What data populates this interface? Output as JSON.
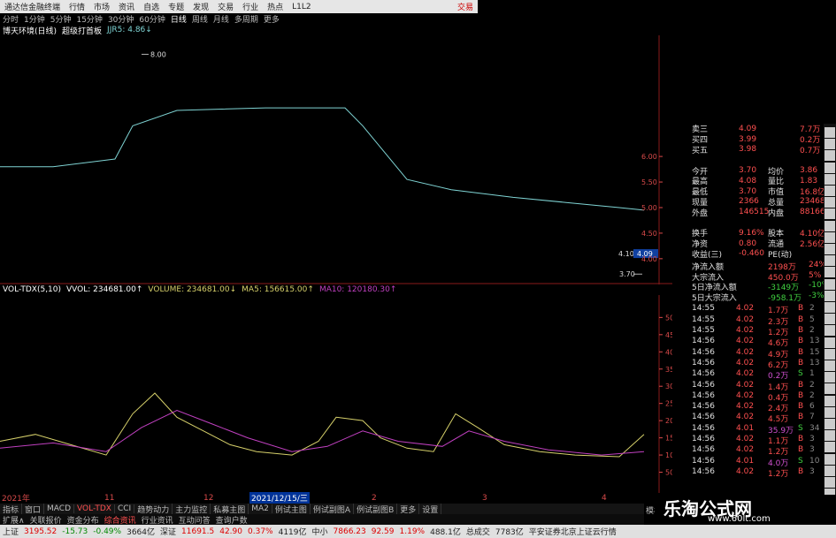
{
  "titlebar": {
    "app": "通达信金融终端",
    "menus": [
      "行情",
      "市场",
      "资讯",
      "自选",
      "专题",
      "发现",
      "交易",
      "行业",
      "热点",
      "L1L2"
    ],
    "right": "交易"
  },
  "periodbar": {
    "items": [
      "分时",
      "1分钟",
      "5分钟",
      "15分钟",
      "30分钟",
      "60分钟",
      "日线",
      "周线",
      "月线",
      "多周期",
      "更多"
    ],
    "active": 6
  },
  "main_legend": {
    "stock": "博天环境(日线)",
    "indicator": "超级打首板",
    "jjr5": "JJR5: 4.86↓"
  },
  "main_axis": {
    "ticks": [
      "6.00",
      "5.50",
      "5.00",
      "4.50",
      "4.00"
    ],
    "high_label": "8.00",
    "low_label": "3.70",
    "cur_left": "4.10",
    "cur_right": "4.09"
  },
  "vol_legend": {
    "name": "VOL-TDX(5,10)",
    "vvol": "VVOL: 234681.00↑",
    "volume": "VOLUME: 234681.00↓",
    "ma5": "MA5: 156615.00↑",
    "ma10": "MA10: 120180.30↑"
  },
  "vol_axis": {
    "ticks": [
      "50000",
      "45000",
      "40000",
      "35000",
      "30000",
      "25000",
      "20000",
      "15000",
      "10000",
      "5000"
    ]
  },
  "dates": {
    "items": [
      "2021年",
      "11",
      "12",
      "2021/12/15/三",
      "2",
      "3",
      "4"
    ]
  },
  "quote": {
    "rows": [
      {
        "l": "卖三",
        "v": "4.09",
        "l2": "",
        "v2": "7.7万"
      },
      {
        "l": "买四",
        "v": "3.99",
        "l2": "",
        "v2": "0.2万"
      },
      {
        "l": "买五",
        "v": "3.98",
        "l2": "",
        "v2": "0.7万"
      },
      {
        "l": "",
        "v": "",
        "l2": "",
        "v2": ""
      },
      {
        "l": "今开",
        "v": "3.70",
        "l2": "均价",
        "v2": "3.86"
      },
      {
        "l": "最高",
        "v": "4.08",
        "l2": "量比",
        "v2": "1.83"
      },
      {
        "l": "最低",
        "v": "3.70",
        "l2": "市值",
        "v2": "16.8亿"
      },
      {
        "l": "现量",
        "v": "2366",
        "l2": "总量",
        "v2": "234681"
      },
      {
        "l": "外盘",
        "v": "146515",
        "l2": "内盘",
        "v2": "88166"
      },
      {
        "l": "",
        "v": "",
        "l2": "",
        "v2": ""
      },
      {
        "l": "换手",
        "v": "9.16%",
        "l2": "股本",
        "v2": "4.10亿"
      },
      {
        "l": "净资",
        "v": "0.80",
        "l2": "流通",
        "v2": "2.56亿"
      },
      {
        "l": "收益(三)",
        "v": "-0.460",
        "l2": "PE(动)",
        "v2": ""
      }
    ]
  },
  "flow": {
    "rows": [
      {
        "l": "净流入额",
        "v": "2198万",
        "p": "24%"
      },
      {
        "l": "大宗流入",
        "v": "450.0万",
        "p": "5%"
      },
      {
        "l": "5日净流入额",
        "v": "-3149万",
        "p": "-10%"
      },
      {
        "l": "5日大宗流入",
        "v": "-958.1万",
        "p": "-3%"
      }
    ]
  },
  "ticks": {
    "rows": [
      {
        "t": "14:55",
        "p": "4.02",
        "v": "1.7万",
        "bs": "B",
        "n": "2"
      },
      {
        "t": "14:55",
        "p": "4.02",
        "v": "2.3万",
        "bs": "B",
        "n": "5"
      },
      {
        "t": "14:55",
        "p": "4.02",
        "v": "1.2万",
        "bs": "B",
        "n": "2"
      },
      {
        "t": "14:56",
        "p": "4.02",
        "v": "4.6万",
        "bs": "B",
        "n": "13"
      },
      {
        "t": "14:56",
        "p": "4.02",
        "v": "4.9万",
        "bs": "B",
        "n": "15"
      },
      {
        "t": "14:56",
        "p": "4.02",
        "v": "6.2万",
        "bs": "B",
        "n": "13"
      },
      {
        "t": "14:56",
        "p": "4.02",
        "v": "0.2万",
        "bs": "S",
        "n": "1"
      },
      {
        "t": "14:56",
        "p": "4.02",
        "v": "1.4万",
        "bs": "B",
        "n": "2"
      },
      {
        "t": "14:56",
        "p": "4.02",
        "v": "0.4万",
        "bs": "B",
        "n": "2"
      },
      {
        "t": "14:56",
        "p": "4.02",
        "v": "2.4万",
        "bs": "B",
        "n": "6"
      },
      {
        "t": "14:56",
        "p": "4.02",
        "v": "4.5万",
        "bs": "B",
        "n": "7"
      },
      {
        "t": "14:56",
        "p": "4.01",
        "v": "35.9万",
        "bs": "S",
        "n": "34"
      },
      {
        "t": "14:56",
        "p": "4.02",
        "v": "1.1万",
        "bs": "B",
        "n": "3"
      },
      {
        "t": "14:56",
        "p": "4.02",
        "v": "1.2万",
        "bs": "B",
        "n": "3"
      },
      {
        "t": "14:56",
        "p": "4.01",
        "v": "4.0万",
        "bs": "S",
        "n": "10"
      },
      {
        "t": "14:56",
        "p": "4.02",
        "v": "1.2万",
        "bs": "B",
        "n": "3"
      }
    ]
  },
  "tabs": {
    "items": [
      "指标",
      "窗口",
      "MACD",
      "VOL-TDX",
      "CCI",
      "趋势动力",
      "主力监控",
      "私募主图",
      "MA2",
      "例试主图",
      "例试副图A",
      "例试副图B",
      "更多",
      "设置"
    ],
    "active": 3,
    "row2": [
      "扩展∧",
      "关联报价",
      "资金分布",
      "综合资讯",
      "行业资讯",
      "互动问答",
      "查询户数"
    ],
    "right": "模板"
  },
  "statusbar": {
    "items": [
      {
        "t": "上证",
        "c": ""
      },
      {
        "t": "3195.52",
        "c": "red"
      },
      {
        "t": "-15.73",
        "c": "green"
      },
      {
        "t": "-0.49%",
        "c": "green"
      },
      {
        "t": "3664亿",
        "c": ""
      },
      {
        "t": "深证",
        "c": ""
      },
      {
        "t": "11691.5",
        "c": "red"
      },
      {
        "t": "42.90",
        "c": "red"
      },
      {
        "t": "0.37%",
        "c": "red"
      },
      {
        "t": "4119亿",
        "c": ""
      },
      {
        "t": "中小",
        "c": ""
      },
      {
        "t": "7866.23",
        "c": "red"
      },
      {
        "t": "92.59",
        "c": "red"
      },
      {
        "t": "1.19%",
        "c": "red"
      },
      {
        "t": "488.1亿",
        "c": ""
      },
      {
        "t": "总成交",
        "c": ""
      },
      {
        "t": "7783亿",
        "c": ""
      },
      {
        "t": "平安证券北京上证云行情",
        "c": ""
      }
    ]
  },
  "watermark": {
    "title": "乐淘公式网",
    "url": "www.60lt.com"
  },
  "colors": {
    "up": "#ff4040",
    "down": "#54ffff",
    "ma": "#7fd4d4",
    "ma5": "#d6d06a",
    "ma10": "#c040c0"
  }
}
